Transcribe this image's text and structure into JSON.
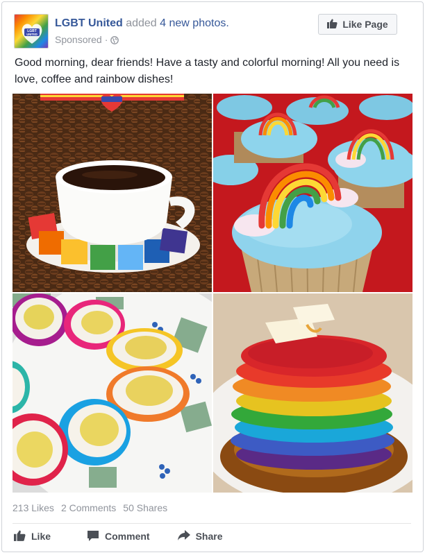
{
  "post": {
    "page_name": "LGBT United",
    "header_action": " added ",
    "header_count": "4 new photos.",
    "sponsored_label": "Sponsored",
    "separator": "·",
    "text": "Good morning, dear friends! Have a tasty and colorful morning! All you need is love, coffee and rainbow dishes!",
    "avatar_text": [
      "LGBT",
      "UNITED"
    ],
    "watermark_text": "LGBT UNITED"
  },
  "header": {
    "like_page_label": "Like Page"
  },
  "photos": [
    {
      "subject": "coffee cup with rainbow sugar cubes on coffee beans"
    },
    {
      "subject": "cupcakes with rainbow candy arches"
    },
    {
      "subject": "rainbow dyed deviled eggs on a plate"
    },
    {
      "subject": "stack of rainbow pancakes with butter and syrup"
    }
  ],
  "stats": {
    "likes": "213 Likes",
    "comments": "2 Comments",
    "shares": "50 Shares"
  },
  "actions": {
    "like": "Like",
    "comment": "Comment",
    "share": "Share"
  },
  "colors": {
    "link_blue": "#365899",
    "meta_gray": "#90949c",
    "action_gray": "#4b4f56",
    "border": "#cfd2d8"
  },
  "icons": [
    "thumbs-up-icon",
    "globe-icon",
    "comment-icon",
    "share-arrow-icon"
  ]
}
